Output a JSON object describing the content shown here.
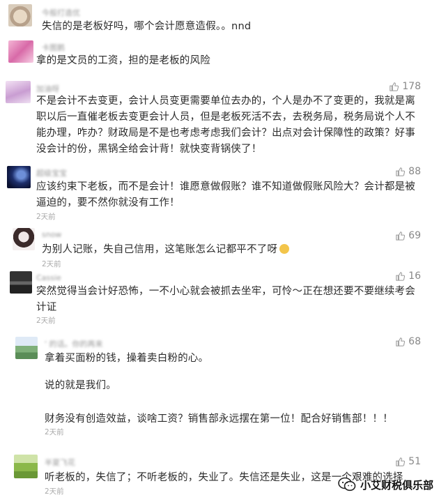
{
  "comments": [
    {
      "username": "今般打造优",
      "text_lines": [
        "失信的是老板好吗，哪个会计愿意造假。。nnd"
      ],
      "likes": "",
      "time": ""
    },
    {
      "username": "卡图鹅",
      "text_lines": [
        "拿的是文员的工资，担的是老板的风险"
      ],
      "likes": "",
      "time": ""
    },
    {
      "username": "加油呀",
      "text_lines": [
        "不是会计不去变更，会计人员变更需要单位去办的，个人是办不了变更的，我就是离职以后一直催老板去变更会计人员，但是老板死活不去，去税务局，税务局说个人不能办理，咋办？财政局是不是也考虑考虑我们会计？出点对会计保障性的政策？好事没会计的份，黑锅全给会计背！就快变背锅侠了！"
      ],
      "likes": "178",
      "time": ""
    },
    {
      "username": "超级宝宝",
      "text_lines": [
        "应该约束下老板，而不是会计！谁愿意做假账？谁不知道做假账风险大？会计都是被逼迫的，要不然你就没有工作！"
      ],
      "likes": "88",
      "time": "2天前"
    },
    {
      "username": "snow",
      "text_lines": [
        "为别人记账，失自己信用，这笔账怎么记都平不了呀"
      ],
      "likes": "69",
      "time": "2天前"
    },
    {
      "username": "Cassie",
      "text_lines": [
        "突然觉得当会计好恐怖，一不小心就会被抓去坐牢，可怜～正在想还要不要继续考会计证"
      ],
      "likes": "16",
      "time": "2天前"
    },
    {
      "username": "' 的话。你的再来",
      "text_lines": [
        "拿着买面粉的钱，操着卖白粉的心。",
        "说的就是我们。",
        "财务没有创造效益，谈啥工资？销售部永远摆在第一位！配合好销售部！！！"
      ],
      "likes": "68",
      "time": "2天前"
    },
    {
      "username": "半夏飞花",
      "text_lines": [
        "听老板的，失信了；不听老板的，失业了。失信还是失业，这是一个艰难的选择"
      ],
      "likes": "51",
      "time": "2天前"
    }
  ],
  "watermark": "小艾财税俱乐部"
}
